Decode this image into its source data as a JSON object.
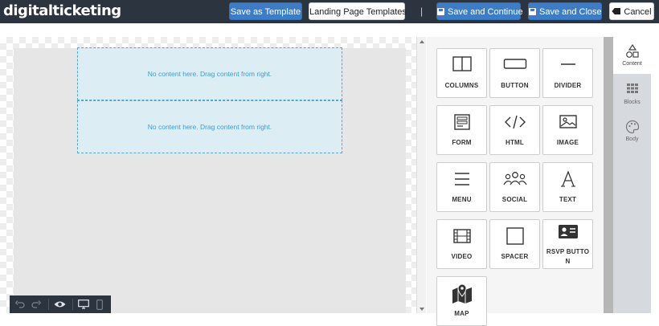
{
  "header": {
    "logo_part1": "digital",
    "logo_part2": "ticketing",
    "save_as_template": "Save as Template",
    "landing_page_templates": "Landing Page Templates",
    "separator": "|",
    "save_and_continue": "Save and Continue",
    "save_and_close": "Save and Close",
    "cancel": "Cancel"
  },
  "canvas": {
    "rows": [
      {
        "placeholder": "No content here. Drag content from right."
      },
      {
        "placeholder": "No content here. Drag content from right."
      }
    ]
  },
  "content_tiles": [
    {
      "label": "COLUMNS",
      "icon": "columns-icon"
    },
    {
      "label": "BUTTON",
      "icon": "button-icon"
    },
    {
      "label": "DIVIDER",
      "icon": "divider-icon"
    },
    {
      "label": "FORM",
      "icon": "form-icon"
    },
    {
      "label": "HTML",
      "icon": "code-icon"
    },
    {
      "label": "IMAGE",
      "icon": "image-icon"
    },
    {
      "label": "MENU",
      "icon": "menu-icon"
    },
    {
      "label": "SOCIAL",
      "icon": "social-icon"
    },
    {
      "label": "TEXT",
      "icon": "text-icon"
    },
    {
      "label": "VIDEO",
      "icon": "video-icon"
    },
    {
      "label": "SPACER",
      "icon": "spacer-icon"
    },
    {
      "label_line1": "RSVP BUTTO",
      "label_line2": "N",
      "icon": "rsvp-card-icon"
    },
    {
      "label": "MAP",
      "icon": "map-icon"
    }
  ],
  "side_tabs": [
    {
      "label": "Content",
      "icon": "shapes-icon",
      "active": true
    },
    {
      "label": "Blocks",
      "icon": "grid-icon",
      "active": false
    },
    {
      "label": "Body",
      "icon": "palette-icon",
      "active": false
    }
  ],
  "bottom_toolbar": {
    "icons": [
      "undo-icon",
      "redo-icon",
      "eye-icon",
      "desktop-icon",
      "mobile-icon"
    ]
  },
  "colors": {
    "topbar": "#2c3440",
    "primary_button": "#3d7dc8",
    "drop_zone_bg": "#dcedf4",
    "drop_zone_border": "#53a7d6",
    "drop_zone_text": "#3b9ed2"
  }
}
